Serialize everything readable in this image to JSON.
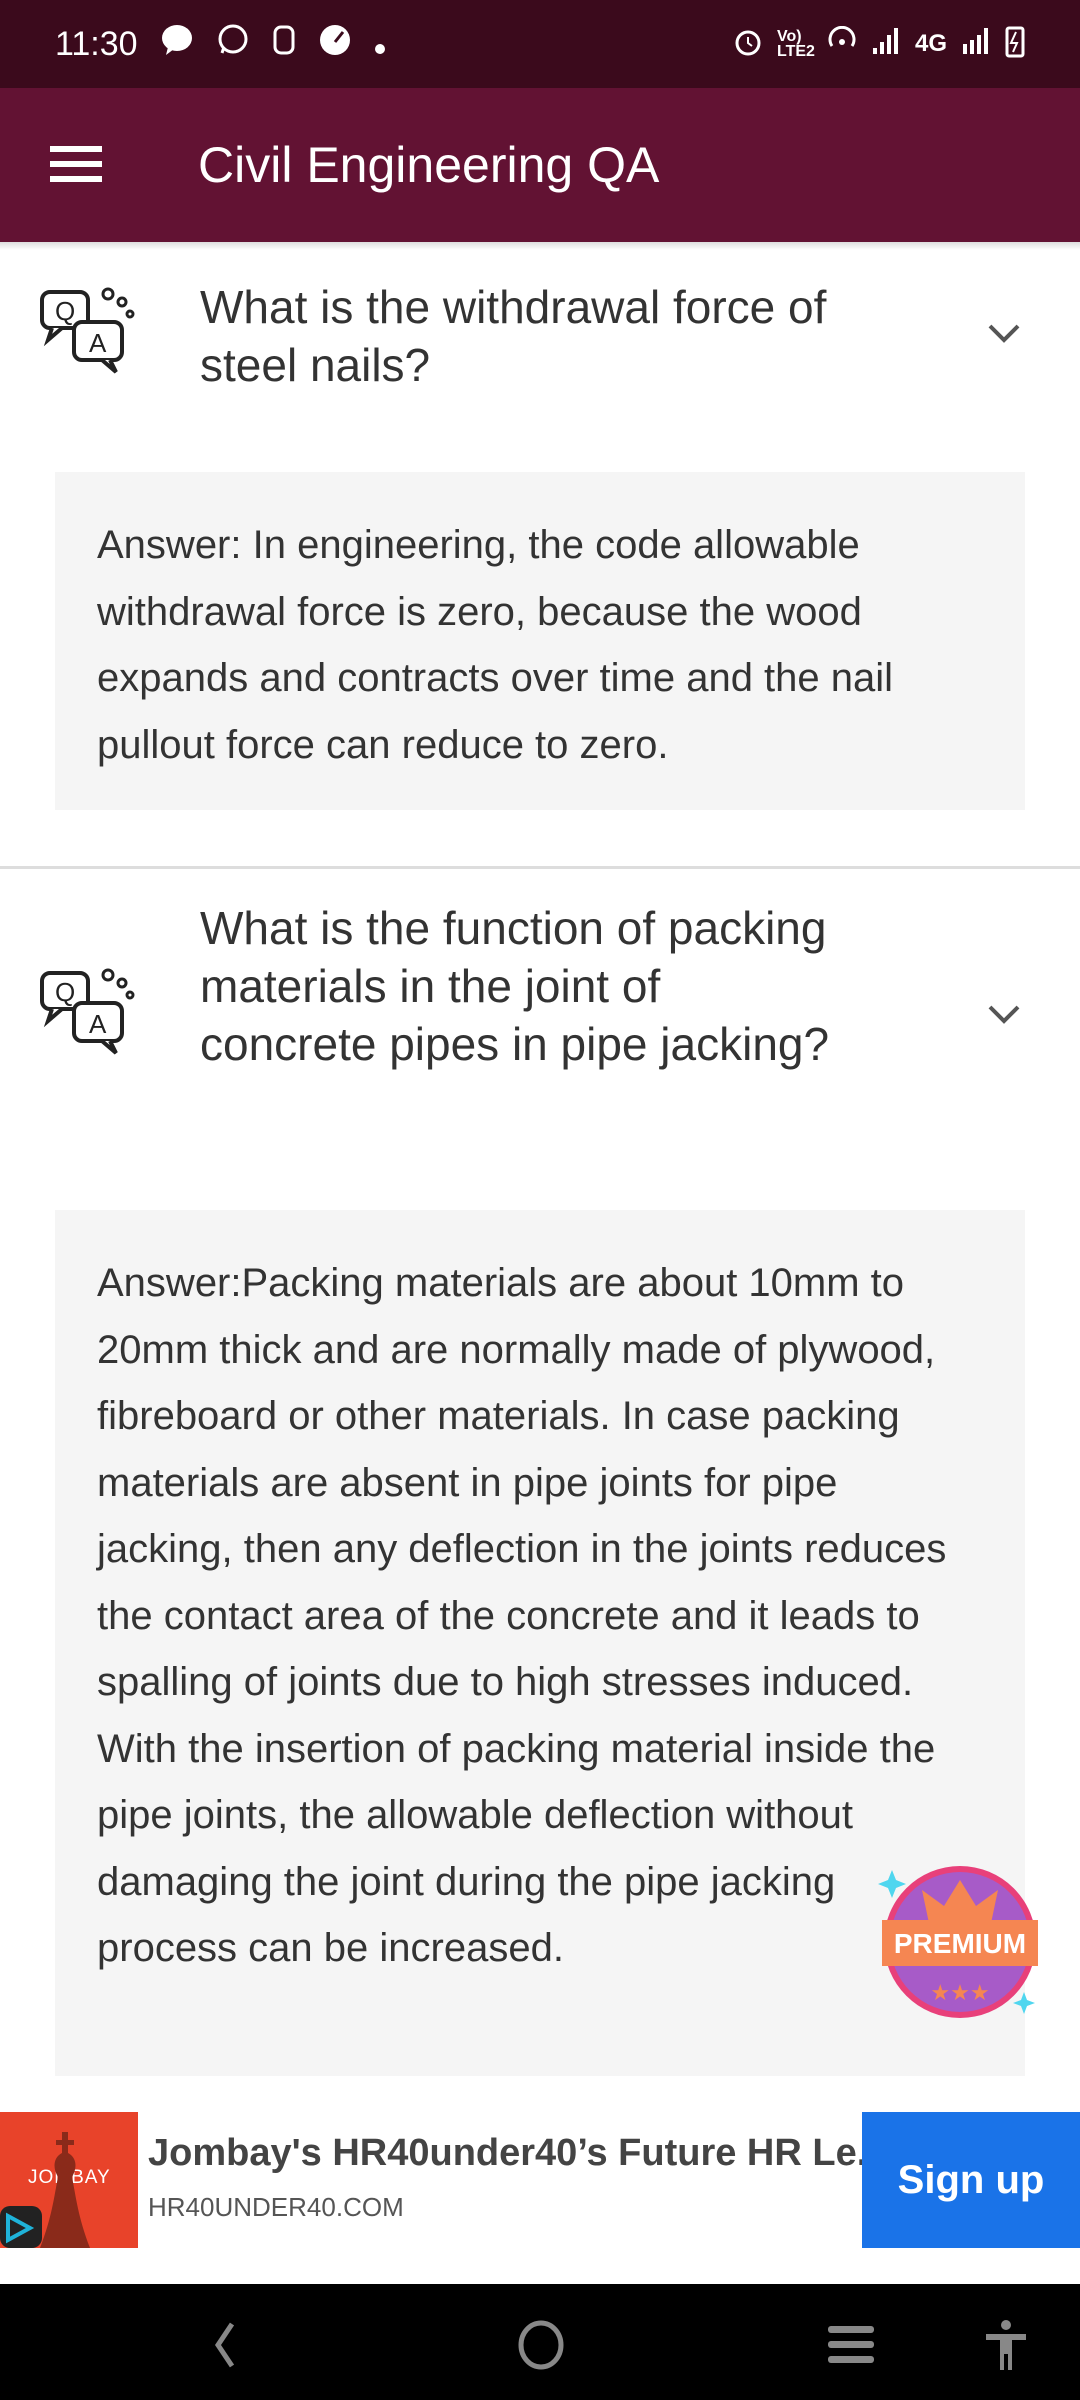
{
  "status_bar": {
    "time": "11:30",
    "network": "4G",
    "volte": "Vo) LTE2"
  },
  "app_bar": {
    "title": "Civil Engineering QA"
  },
  "qa_items": [
    {
      "question": "What is the withdrawal force of steel nails?",
      "answer": "Answer: In engineering, the code allowable withdrawal force is zero, because the wood expands and contracts over time and the nail pullout force can reduce to zero.",
      "expanded": true
    },
    {
      "question": "What is the function of packing materials in the joint of concrete pipes in pipe jacking?",
      "answer": "Answer:Packing materials are about 10mm to 20mm thick and are normally made of plywood, fibreboard or other materials. In case packing materials are absent in pipe joints for pipe jacking, then any deflection in the joints reduces the contact area of the concrete and it leads to spalling of joints due to high stresses induced. With the insertion of packing material inside the pipe joints, the allowable deflection without damaging the joint during the pipe jacking process can be increased.",
      "expanded": true
    }
  ],
  "premium_badge": {
    "label": "PREMIUM"
  },
  "ad": {
    "brand": "JOMBAY",
    "title": "Jombay's HR40under40’s Future HR Le...",
    "url": "HR40UNDER40.COM",
    "cta": "Sign up"
  },
  "colors": {
    "app_bar": "#621233",
    "status_bar": "#3b0a1c",
    "cta": "#1a73e8",
    "answer_bg": "#f5f5f5"
  }
}
